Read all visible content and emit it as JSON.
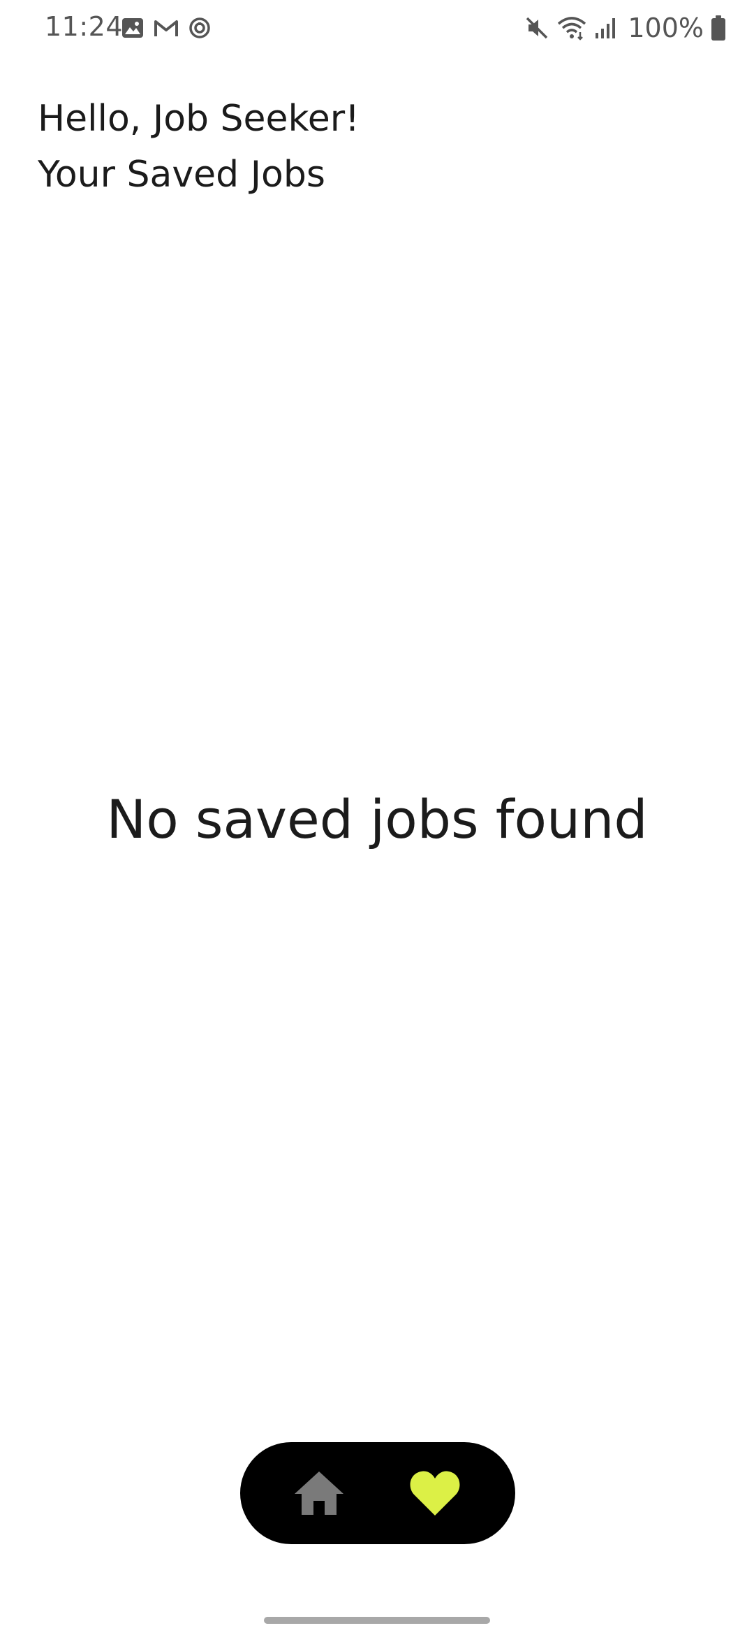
{
  "status_bar": {
    "time": "11:24",
    "battery_text": "100%",
    "left_icons": [
      "image-icon",
      "gmail-icon",
      "sync-icon"
    ],
    "right_icons": [
      "mute-icon",
      "wifi-icon",
      "signal-icon",
      "battery-icon"
    ]
  },
  "header": {
    "greeting": "Hello, Job Seeker!",
    "subtitle": "Your Saved Jobs"
  },
  "main": {
    "empty_message": "No saved jobs found"
  },
  "bottom_nav": {
    "items": [
      {
        "icon": "home-icon",
        "active": false,
        "color": "#7a7a7a"
      },
      {
        "icon": "heart-icon",
        "active": true,
        "color": "#dcf046"
      }
    ],
    "background": "#000000"
  }
}
